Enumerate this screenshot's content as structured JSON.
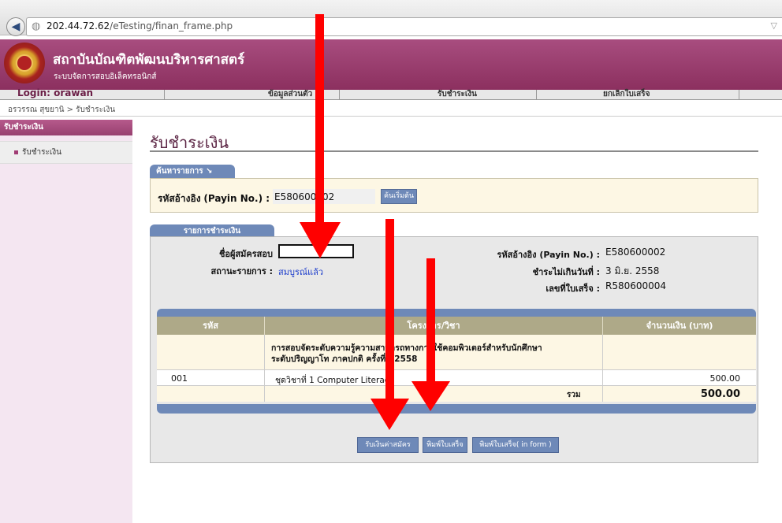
{
  "browser": {
    "url_host": "202.44.72.62",
    "url_path": "/eTesting/finan_frame.php",
    "back_icon": "back-arrow-icon",
    "globe_icon": "globe-icon"
  },
  "header": {
    "title": "สถาบันบัณฑิตพัฒนบริหารศาสตร์",
    "subtitle": "ระบบจัดการสอบอิเล็คทรอนิกส์",
    "color": "#9a3d6e"
  },
  "nav": {
    "login": "Login: orawan",
    "items": [
      "ข้อมูลส่วนตัว",
      "รับชำระเงิน",
      "ยกเลิกใบเสร็จ"
    ]
  },
  "breadcrumb": "อรวรรณ สุขยานิ > รับชำระเงิน",
  "sidebar": {
    "heading": "รับชำระเงิน",
    "items": [
      {
        "label": "รับชำระเงิน"
      }
    ]
  },
  "main": {
    "page_title": "รับชำระเงิน",
    "search": {
      "tab_label": "ค้นหารายการ ↘",
      "field_label_th": "รหัสอ้างอิง",
      "field_label_en": "(Payin No.) :",
      "field_value": "E580600002",
      "button": "ค้นเริ่มต้น"
    },
    "payment": {
      "tab_label": "รายการชำระเงิน",
      "applicant_label": "ชื่อผู้สมัครสอบ",
      "status_label": "สถานะรายการ :",
      "status_value": "สมบูรณ์แล้ว",
      "ref_label": "รหัสอ้างอิง (Payin No.) :",
      "ref_value": "E580600002",
      "due_label": "ชำระไม่เกินวันที่ :",
      "due_value": "3 มิ.ย. 2558",
      "receipt_label": "เลขที่ใบเสร็จ :",
      "receipt_value": "R580600004",
      "table": {
        "headers": [
          "รหัส",
          "โครงการ/วิชา",
          "จำนวนเงิน (บาท)"
        ],
        "project_line1": "การสอบจัดระดับความรู้ความสามารถทางการใช้คอมพิวเตอร์สำหรับนักศึกษา",
        "project_line2": "ระดับปริญญาโท ภาคปกติ ครั้งที่4/2558",
        "rows": [
          {
            "code": "001",
            "subject": "ชุดวิชาที่ 1 Computer Literacy",
            "amount": "500.00"
          }
        ],
        "total_label": "รวม",
        "total_value": "500.00"
      },
      "buttons": [
        "รับเงินค่าสมัคร",
        "พิมพ์ใบเสร็จ",
        "พิมพ์ใบเสร็จ( in form )"
      ]
    }
  },
  "annotation_color": "#ff0000"
}
